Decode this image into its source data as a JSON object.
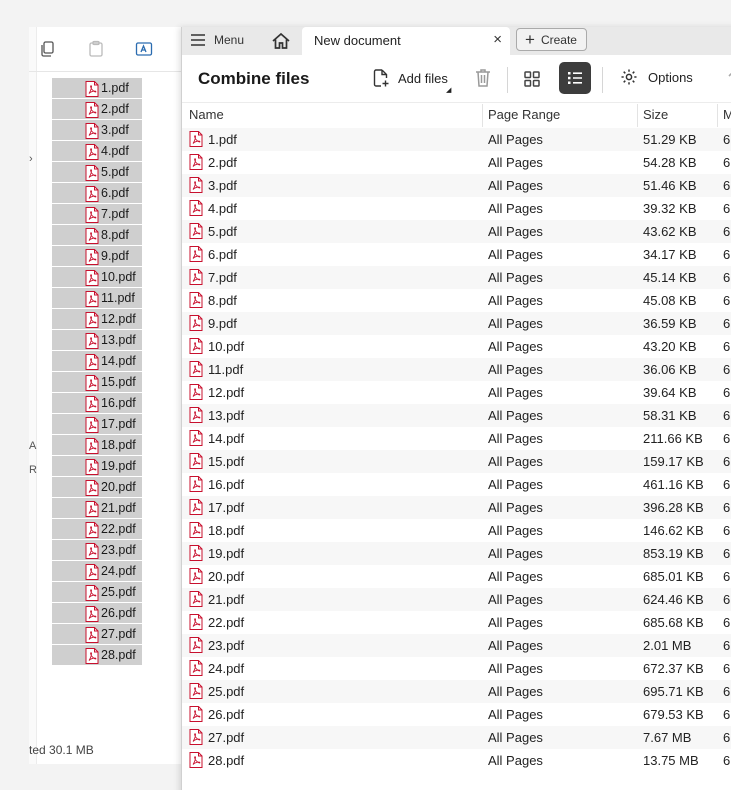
{
  "explorer": {
    "files": [
      "1.pdf",
      "2.pdf",
      "3.pdf",
      "4.pdf",
      "5.pdf",
      "6.pdf",
      "7.pdf",
      "8.pdf",
      "9.pdf",
      "10.pdf",
      "11.pdf",
      "12.pdf",
      "13.pdf",
      "14.pdf",
      "15.pdf",
      "16.pdf",
      "17.pdf",
      "18.pdf",
      "19.pdf",
      "20.pdf",
      "21.pdf",
      "22.pdf",
      "23.pdf",
      "24.pdf",
      "25.pdf",
      "26.pdf",
      "27.pdf",
      "28.pdf"
    ],
    "status": "ted  30.1 MB",
    "stub_a": "A",
    "stub_r": "R"
  },
  "tabbar": {
    "menu_label": "Menu",
    "doc_tab_label": "New document",
    "close_label": "×",
    "create_label": "Create"
  },
  "toolbar": {
    "title": "Combine files",
    "add_files_label": "Add files",
    "options_label": "Options"
  },
  "table": {
    "columns": [
      "Name",
      "Page Range",
      "Size",
      "M"
    ],
    "rows": [
      {
        "name": "1.pdf",
        "range": "All Pages",
        "size": "51.29 KB",
        "mod": "6"
      },
      {
        "name": "2.pdf",
        "range": "All Pages",
        "size": "54.28 KB",
        "mod": "6"
      },
      {
        "name": "3.pdf",
        "range": "All Pages",
        "size": "51.46 KB",
        "mod": "6"
      },
      {
        "name": "4.pdf",
        "range": "All Pages",
        "size": "39.32 KB",
        "mod": "6"
      },
      {
        "name": "5.pdf",
        "range": "All Pages",
        "size": "43.62 KB",
        "mod": "6"
      },
      {
        "name": "6.pdf",
        "range": "All Pages",
        "size": "34.17 KB",
        "mod": "6"
      },
      {
        "name": "7.pdf",
        "range": "All Pages",
        "size": "45.14 KB",
        "mod": "6"
      },
      {
        "name": "8.pdf",
        "range": "All Pages",
        "size": "45.08 KB",
        "mod": "6"
      },
      {
        "name": "9.pdf",
        "range": "All Pages",
        "size": "36.59 KB",
        "mod": "6"
      },
      {
        "name": "10.pdf",
        "range": "All Pages",
        "size": "43.20 KB",
        "mod": "6"
      },
      {
        "name": "11.pdf",
        "range": "All Pages",
        "size": "36.06 KB",
        "mod": "6"
      },
      {
        "name": "12.pdf",
        "range": "All Pages",
        "size": "39.64 KB",
        "mod": "6"
      },
      {
        "name": "13.pdf",
        "range": "All Pages",
        "size": "58.31 KB",
        "mod": "6"
      },
      {
        "name": "14.pdf",
        "range": "All Pages",
        "size": "211.66 KB",
        "mod": "6"
      },
      {
        "name": "15.pdf",
        "range": "All Pages",
        "size": "159.17 KB",
        "mod": "6"
      },
      {
        "name": "16.pdf",
        "range": "All Pages",
        "size": "461.16 KB",
        "mod": "6"
      },
      {
        "name": "17.pdf",
        "range": "All Pages",
        "size": "396.28 KB",
        "mod": "6"
      },
      {
        "name": "18.pdf",
        "range": "All Pages",
        "size": "146.62 KB",
        "mod": "6"
      },
      {
        "name": "19.pdf",
        "range": "All Pages",
        "size": "853.19 KB",
        "mod": "6"
      },
      {
        "name": "20.pdf",
        "range": "All Pages",
        "size": "685.01 KB",
        "mod": "6"
      },
      {
        "name": "21.pdf",
        "range": "All Pages",
        "size": "624.46 KB",
        "mod": "6"
      },
      {
        "name": "22.pdf",
        "range": "All Pages",
        "size": "685.68 KB",
        "mod": "6"
      },
      {
        "name": "23.pdf",
        "range": "All Pages",
        "size": "2.01 MB",
        "mod": "6"
      },
      {
        "name": "24.pdf",
        "range": "All Pages",
        "size": "672.37 KB",
        "mod": "6"
      },
      {
        "name": "25.pdf",
        "range": "All Pages",
        "size": "695.71 KB",
        "mod": "6"
      },
      {
        "name": "26.pdf",
        "range": "All Pages",
        "size": "679.53 KB",
        "mod": "6"
      },
      {
        "name": "27.pdf",
        "range": "All Pages",
        "size": "7.67 MB",
        "mod": "6"
      },
      {
        "name": "28.pdf",
        "range": "All Pages",
        "size": "13.75 MB",
        "mod": "6"
      }
    ]
  },
  "colors": {
    "pdf_red": "#c8102e",
    "selected_bg": "#cfcfcf",
    "active_view_bg": "#3d3d3d"
  },
  "icons": {
    "file_icon": "pdf-file-icon",
    "home": "home-icon",
    "menu": "hamburger-icon",
    "create": "plus-icon",
    "add_files": "add-file-icon",
    "delete": "trash-icon",
    "grid": "grid-view-icon",
    "list": "list-view-icon",
    "options": "gear-icon",
    "upload": "up-arrow-icon"
  }
}
